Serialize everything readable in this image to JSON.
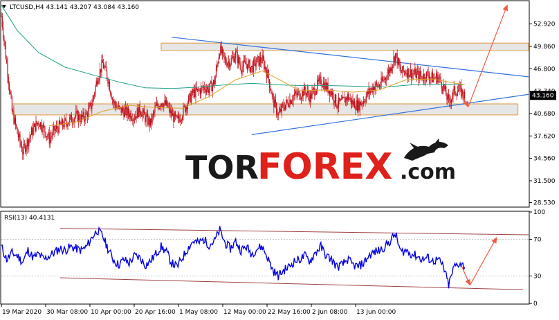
{
  "header": {
    "symbol_line": "LTCUSD,H4  43.141 43.207 43.084 43.160",
    "rsi_line": "RSI(13) 40.4131"
  },
  "watermark": {
    "part1": "TOR",
    "part2": "FOREX",
    "part3": ".com"
  },
  "colors": {
    "candle": "#c0101a",
    "ma_fast": "#e0a020",
    "ma_slow": "#20a088",
    "trendline": "#3070e0",
    "arrow": "#f05a40",
    "zone_fill": "#e6e6e6",
    "zone_border": "#e0a860",
    "rsi_line": "#0000e0",
    "rsi_channel": "#a04040",
    "watermark_dark": "#1a1a1a",
    "watermark_red": "#e0201a"
  },
  "chart_data": [
    {
      "type": "candlestick",
      "symbol": "LTCUSD",
      "timeframe": "H4",
      "ohlc_last": {
        "open": 43.141,
        "high": 43.207,
        "low": 43.084,
        "close": 43.16
      },
      "current_price": 43.16,
      "current_price_label": "43.160",
      "ylim": [
        28.0,
        56.0
      ],
      "y_ticks": [
        28.53,
        31.5,
        34.56,
        37.62,
        40.68,
        43.74,
        46.8,
        49.86,
        52.92
      ],
      "y_tick_labels": [
        "28.530",
        "31.500",
        "34.560",
        "37.620",
        "40.680",
        "43.740",
        "46.800",
        "49.860",
        "52.920"
      ],
      "x_tick_labels": [
        "19 Mar 2020",
        "30 Mar 08:00",
        "10 Apr 00:00",
        "20 Apr 16:00",
        "1 May 08:00",
        "12 May 00:00",
        "22 May 16:00",
        "2 Jun 08:00",
        "13 Jun 00:00"
      ],
      "x_range": [
        "2020-03-19",
        "2020-06-26"
      ],
      "price_path": [
        [
          "2020-03-19 00:00",
          54.0
        ],
        [
          "2020-03-20 00:00",
          47.5
        ],
        [
          "2020-03-21 00:00",
          41.0
        ],
        [
          "2020-03-22 00:00",
          38.0
        ],
        [
          "2020-03-23 00:00",
          35.5
        ],
        [
          "2020-03-24 00:00",
          37.0
        ],
        [
          "2020-03-25 00:00",
          38.6
        ],
        [
          "2020-03-26 00:00",
          39.6
        ],
        [
          "2020-03-27 00:00",
          38.6
        ],
        [
          "2020-03-28 00:00",
          37.2
        ],
        [
          "2020-03-29 00:00",
          38.4
        ],
        [
          "2020-03-30 00:00",
          39.0
        ],
        [
          "2020-03-31 00:00",
          39.4
        ],
        [
          "2020-04-01 00:00",
          39.9
        ],
        [
          "2020-04-02 00:00",
          40.4
        ],
        [
          "2020-04-03 00:00",
          40.0
        ],
        [
          "2020-04-04 00:00",
          40.5
        ],
        [
          "2020-04-05 00:00",
          42.0
        ],
        [
          "2020-04-06 00:00",
          45.5
        ],
        [
          "2020-04-07 00:00",
          47.5
        ],
        [
          "2020-04-08 00:00",
          45.5
        ],
        [
          "2020-04-09 00:00",
          42.2
        ],
        [
          "2020-04-10 00:00",
          41.3
        ],
        [
          "2020-04-11 00:00",
          41.0
        ],
        [
          "2020-04-12 00:00",
          40.7
        ],
        [
          "2020-04-13 00:00",
          40.3
        ],
        [
          "2020-04-14 00:00",
          41.3
        ],
        [
          "2020-04-15 00:00",
          40.1
        ],
        [
          "2020-04-16 00:00",
          39.3
        ],
        [
          "2020-04-17 00:00",
          41.5
        ],
        [
          "2020-04-18 00:00",
          42.3
        ],
        [
          "2020-04-19 00:00",
          41.8
        ],
        [
          "2020-04-20 00:00",
          40.5
        ],
        [
          "2020-04-21 00:00",
          39.6
        ],
        [
          "2020-04-22 00:00",
          40.8
        ],
        [
          "2020-04-23 00:00",
          42.3
        ],
        [
          "2020-04-24 00:00",
          43.5
        ],
        [
          "2020-04-25 00:00",
          43.7
        ],
        [
          "2020-04-26 00:00",
          44.3
        ],
        [
          "2020-04-27 00:00",
          44.0
        ],
        [
          "2020-04-28 00:00",
          45.0
        ],
        [
          "2020-04-29 00:00",
          49.5
        ],
        [
          "2020-04-30 00:00",
          47.8
        ],
        [
          "2020-05-01 00:00",
          47.8
        ],
        [
          "2020-05-02 00:00",
          48.8
        ],
        [
          "2020-05-03 00:00",
          47.0
        ],
        [
          "2020-05-04 00:00",
          47.5
        ],
        [
          "2020-05-05 00:00",
          46.9
        ],
        [
          "2020-05-06 00:00",
          47.8
        ],
        [
          "2020-05-07 00:00",
          48.0
        ],
        [
          "2020-05-08 00:00",
          46.0
        ],
        [
          "2020-05-09 00:00",
          42.5
        ],
        [
          "2020-05-10 00:00",
          40.5
        ],
        [
          "2020-05-11 00:00",
          41.7
        ],
        [
          "2020-05-12 00:00",
          42.4
        ],
        [
          "2020-05-13 00:00",
          43.2
        ],
        [
          "2020-05-14 00:00",
          43.3
        ],
        [
          "2020-05-15 00:00",
          43.8
        ],
        [
          "2020-05-16 00:00",
          42.9
        ],
        [
          "2020-05-17 00:00",
          44.2
        ],
        [
          "2020-05-18 00:00",
          45.2
        ],
        [
          "2020-05-19 00:00",
          44.3
        ],
        [
          "2020-05-20 00:00",
          43.6
        ],
        [
          "2020-05-21 00:00",
          42.0
        ],
        [
          "2020-05-22 00:00",
          42.2
        ],
        [
          "2020-05-23 00:00",
          43.0
        ],
        [
          "2020-05-24 00:00",
          42.1
        ],
        [
          "2020-05-25 00:00",
          41.8
        ],
        [
          "2020-05-26 00:00",
          42.5
        ],
        [
          "2020-05-27 00:00",
          43.6
        ],
        [
          "2020-05-28 00:00",
          44.4
        ],
        [
          "2020-05-29 00:00",
          44.5
        ],
        [
          "2020-05-30 00:00",
          45.5
        ],
        [
          "2020-05-31 00:00",
          46.8
        ],
        [
          "2020-06-01 00:00",
          48.8
        ],
        [
          "2020-06-02 00:00",
          46.3
        ],
        [
          "2020-06-03 00:00",
          46.5
        ],
        [
          "2020-06-04 00:00",
          46.2
        ],
        [
          "2020-06-05 00:00",
          46.0
        ],
        [
          "2020-06-06 00:00",
          45.7
        ],
        [
          "2020-06-07 00:00",
          46.0
        ],
        [
          "2020-06-08 00:00",
          45.5
        ],
        [
          "2020-06-09 00:00",
          45.7
        ],
        [
          "2020-06-10 00:00",
          44.3
        ],
        [
          "2020-06-11 00:00",
          42.2
        ],
        [
          "2020-06-12 00:00",
          43.7
        ],
        [
          "2020-06-13 00:00",
          43.9
        ],
        [
          "2020-06-14 00:00",
          43.16
        ]
      ],
      "ma_slow_path": [
        [
          "2020-03-19 00:00",
          55.5
        ],
        [
          "2020-03-22 00:00",
          52.0
        ],
        [
          "2020-03-26 00:00",
          49.0
        ],
        [
          "2020-03-31 00:00",
          47.0
        ],
        [
          "2020-04-05 00:00",
          46.0
        ],
        [
          "2020-04-10 00:00",
          45.0
        ],
        [
          "2020-04-15 00:00",
          44.2
        ],
        [
          "2020-04-20 00:00",
          44.1
        ],
        [
          "2020-04-25 00:00",
          44.3
        ],
        [
          "2020-04-30 00:00",
          44.6
        ],
        [
          "2020-05-05 00:00",
          44.8
        ],
        [
          "2020-05-10 00:00",
          44.6
        ],
        [
          "2020-05-15 00:00",
          44.5
        ],
        [
          "2020-05-20 00:00",
          44.5
        ],
        [
          "2020-05-25 00:00",
          44.4
        ],
        [
          "2020-05-30 00:00",
          44.3
        ],
        [
          "2020-06-04 00:00",
          44.6
        ],
        [
          "2020-06-09 00:00",
          44.7
        ],
        [
          "2020-06-14 00:00",
          44.6
        ]
      ],
      "ma_fast_path": [
        [
          "2020-03-28 00:00",
          39.0
        ],
        [
          "2020-04-02 00:00",
          39.5
        ],
        [
          "2020-04-07 00:00",
          41.0
        ],
        [
          "2020-04-12 00:00",
          41.8
        ],
        [
          "2020-04-17 00:00",
          41.5
        ],
        [
          "2020-04-22 00:00",
          41.4
        ],
        [
          "2020-04-27 00:00",
          43.0
        ],
        [
          "2020-05-02 00:00",
          45.3
        ],
        [
          "2020-05-07 00:00",
          46.5
        ],
        [
          "2020-05-10 00:00",
          45.4
        ],
        [
          "2020-05-14 00:00",
          43.8
        ],
        [
          "2020-05-19 00:00",
          43.9
        ],
        [
          "2020-05-24 00:00",
          43.6
        ],
        [
          "2020-05-29 00:00",
          43.9
        ],
        [
          "2020-06-03 00:00",
          45.3
        ],
        [
          "2020-06-08 00:00",
          45.4
        ],
        [
          "2020-06-14 00:00",
          44.6
        ]
      ],
      "zones": [
        {
          "from": 49.3,
          "to": 50.3
        },
        {
          "from": 40.5,
          "to": 42.0
        }
      ],
      "zone_time_spans": [
        [
          "2020-04-18 00:00",
          "2020-06-26 00:00"
        ],
        [
          "2020-03-21 00:00",
          "2020-06-24 00:00"
        ]
      ],
      "trendlines": [
        {
          "from": [
            "2020-04-20 00:00",
            51.1
          ],
          "to": [
            "2020-06-26 00:00",
            45.7
          ]
        },
        {
          "from": [
            "2020-05-05 00:00",
            37.8
          ],
          "to": [
            "2020-06-26 00:00",
            43.3
          ]
        }
      ],
      "forecast_arrows": [
        {
          "from": [
            "2020-06-13 00:00",
            44.0
          ],
          "to": [
            "2020-06-14 16:00",
            41.6
          ]
        },
        {
          "from": [
            "2020-06-14 16:00",
            41.6
          ],
          "to": [
            "2020-06-22 00:00",
            55.5
          ]
        }
      ]
    },
    {
      "type": "line",
      "indicator": "RSI",
      "period": 13,
      "current_value": 40.4131,
      "ylim": [
        0,
        100
      ],
      "y_ticks": [
        0,
        30,
        70,
        100
      ],
      "y_tick_labels": [
        "0",
        "30",
        "70",
        "100"
      ],
      "levels": [
        30,
        70
      ],
      "series": [
        {
          "values": [
            [
              "2020-03-19 00:00",
              62
            ],
            [
              "2020-03-20 00:00",
              48
            ],
            [
              "2020-03-21 00:00",
              55
            ],
            [
              "2020-03-22 00:00",
              52
            ],
            [
              "2020-03-23 00:00",
              45
            ],
            [
              "2020-03-24 00:00",
              58
            ],
            [
              "2020-03-25 00:00",
              50
            ],
            [
              "2020-03-26 00:00",
              54
            ],
            [
              "2020-03-27 00:00",
              48
            ],
            [
              "2020-03-28 00:00",
              52
            ],
            [
              "2020-03-29 00:00",
              56
            ],
            [
              "2020-03-30 00:00",
              60
            ],
            [
              "2020-03-31 00:00",
              58
            ],
            [
              "2020-04-01 00:00",
              62
            ],
            [
              "2020-04-02 00:00",
              60
            ],
            [
              "2020-04-03 00:00",
              58
            ],
            [
              "2020-04-04 00:00",
              62
            ],
            [
              "2020-04-05 00:00",
              72
            ],
            [
              "2020-04-06 00:00",
              80
            ],
            [
              "2020-04-07 00:00",
              74
            ],
            [
              "2020-04-08 00:00",
              60
            ],
            [
              "2020-04-09 00:00",
              48
            ],
            [
              "2020-04-10 00:00",
              42
            ],
            [
              "2020-04-11 00:00",
              48
            ],
            [
              "2020-04-12 00:00",
              44
            ],
            [
              "2020-04-13 00:00",
              52
            ],
            [
              "2020-04-14 00:00",
              50
            ],
            [
              "2020-04-15 00:00",
              42
            ],
            [
              "2020-04-16 00:00",
              46
            ],
            [
              "2020-04-17 00:00",
              54
            ],
            [
              "2020-04-18 00:00",
              62
            ],
            [
              "2020-04-19 00:00",
              56
            ],
            [
              "2020-04-20 00:00",
              44
            ],
            [
              "2020-04-21 00:00",
              40
            ],
            [
              "2020-04-22 00:00",
              50
            ],
            [
              "2020-04-23 00:00",
              60
            ],
            [
              "2020-04-24 00:00",
              68
            ],
            [
              "2020-04-25 00:00",
              66
            ],
            [
              "2020-04-26 00:00",
              70
            ],
            [
              "2020-04-27 00:00",
              64
            ],
            [
              "2020-04-28 00:00",
              68
            ],
            [
              "2020-04-29 00:00",
              80
            ],
            [
              "2020-04-30 00:00",
              66
            ],
            [
              "2020-05-01 00:00",
              60
            ],
            [
              "2020-05-02 00:00",
              68
            ],
            [
              "2020-05-03 00:00",
              58
            ],
            [
              "2020-05-04 00:00",
              62
            ],
            [
              "2020-05-05 00:00",
              54
            ],
            [
              "2020-05-06 00:00",
              60
            ],
            [
              "2020-05-07 00:00",
              62
            ],
            [
              "2020-05-08 00:00",
              50
            ],
            [
              "2020-05-09 00:00",
              36
            ],
            [
              "2020-05-10 00:00",
              30
            ],
            [
              "2020-05-11 00:00",
              36
            ],
            [
              "2020-05-12 00:00",
              40
            ],
            [
              "2020-05-13 00:00",
              46
            ],
            [
              "2020-05-14 00:00",
              48
            ],
            [
              "2020-05-15 00:00",
              52
            ],
            [
              "2020-05-16 00:00",
              46
            ],
            [
              "2020-05-17 00:00",
              56
            ],
            [
              "2020-05-18 00:00",
              62
            ],
            [
              "2020-05-19 00:00",
              52
            ],
            [
              "2020-05-20 00:00",
              48
            ],
            [
              "2020-05-21 00:00",
              40
            ],
            [
              "2020-05-22 00:00",
              42
            ],
            [
              "2020-05-23 00:00",
              48
            ],
            [
              "2020-05-24 00:00",
              42
            ],
            [
              "2020-05-25 00:00",
              40
            ],
            [
              "2020-05-26 00:00",
              44
            ],
            [
              "2020-05-27 00:00",
              52
            ],
            [
              "2020-05-28 00:00",
              56
            ],
            [
              "2020-05-29 00:00",
              58
            ],
            [
              "2020-05-30 00:00",
              62
            ],
            [
              "2020-05-31 00:00",
              68
            ],
            [
              "2020-06-01 00:00",
              76
            ],
            [
              "2020-06-02 00:00",
              56
            ],
            [
              "2020-06-03 00:00",
              58
            ],
            [
              "2020-06-04 00:00",
              54
            ],
            [
              "2020-06-05 00:00",
              52
            ],
            [
              "2020-06-06 00:00",
              48
            ],
            [
              "2020-06-07 00:00",
              50
            ],
            [
              "2020-06-08 00:00",
              46
            ],
            [
              "2020-06-09 00:00",
              48
            ],
            [
              "2020-06-10 00:00",
              40
            ],
            [
              "2020-06-11 00:00",
              20
            ],
            [
              "2020-06-12 00:00",
              40
            ],
            [
              "2020-06-13 00:00",
              44
            ],
            [
              "2020-06-14 00:00",
              40.4
            ]
          ]
        }
      ],
      "channel_lines": [
        {
          "from": [
            "2020-03-30 00:00",
            82
          ],
          "to": [
            "2020-06-26 00:00",
            75
          ]
        },
        {
          "from": [
            "2020-03-30 00:00",
            28
          ],
          "to": [
            "2020-06-25 00:00",
            15
          ]
        }
      ],
      "forecast_arrows": [
        {
          "from": [
            "2020-06-13 08:00",
            42
          ],
          "to": [
            "2020-06-15 00:00",
            20
          ]
        },
        {
          "from": [
            "2020-06-15 00:00",
            20
          ],
          "to": [
            "2020-06-20 00:00",
            72
          ]
        }
      ]
    }
  ]
}
